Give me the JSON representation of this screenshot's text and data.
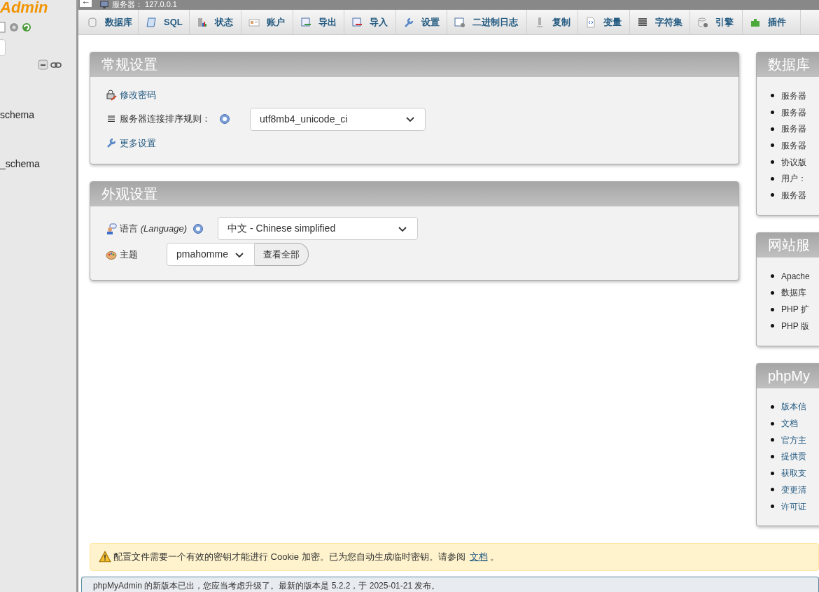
{
  "sidebar": {
    "logo_text": "Admin",
    "databases": [
      "schema",
      "_schema"
    ]
  },
  "breadcrumb": {
    "back": "←",
    "server": "服务器： 127.0.0.1"
  },
  "tabs": [
    {
      "label": "数据库"
    },
    {
      "label": "SQL"
    },
    {
      "label": "状态"
    },
    {
      "label": "账户"
    },
    {
      "label": "导出"
    },
    {
      "label": "导入"
    },
    {
      "label": "设置"
    },
    {
      "label": "二进制日志"
    },
    {
      "label": "复制"
    },
    {
      "label": "变量"
    },
    {
      "label": "字符集"
    },
    {
      "label": "引擎"
    },
    {
      "label": "插件"
    }
  ],
  "general_settings": {
    "title": "常规设置",
    "change_password": "修改密码",
    "collation_label": "服务器连接排序规则：",
    "collation_value": "utf8mb4_unicode_ci",
    "more_settings": "更多设置"
  },
  "appearance_settings": {
    "title": "外观设置",
    "language_label": "语言 *(Language)*",
    "language_value": "中文 - Chinese simplified",
    "theme_label": "主题",
    "theme_value": "pmahomme",
    "view_all": "查看全部"
  },
  "right_panels": [
    {
      "title": "数据库",
      "items": [
        "服务器",
        "服务器",
        "服务器",
        "服务器",
        "协议版",
        "用户：",
        "服务器"
      ],
      "links": false
    },
    {
      "title": "网站服",
      "items": [
        "Apache",
        "数据库",
        "PHP 扩",
        "PHP 版"
      ],
      "links": false
    },
    {
      "title": "phpMy",
      "items": [
        "版本信",
        "文档",
        "官方主",
        "提供贡",
        "获取支",
        "变更清",
        "许可证"
      ],
      "links": true
    }
  ],
  "warning": {
    "text": "配置文件需要一个有效的密钥才能进行 Cookie 加密。已为您自动生成临时密钥。请参阅",
    "link": "文档",
    "end": "。"
  },
  "notice": {
    "text": "phpMyAdmin 的新版本已出，您应当考虑升级了。最新的版本是 5.2.2，于 2025-01-21 发布。"
  }
}
